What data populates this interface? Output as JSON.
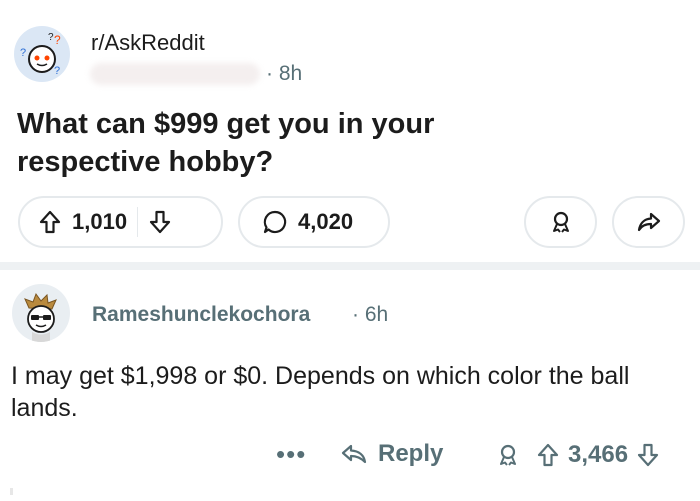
{
  "post": {
    "subreddit": "r/AskReddit",
    "time": "8h",
    "title": "What can $999 get you in your respective hobby?",
    "votes": "1,010",
    "comments": "4,020"
  },
  "comment": {
    "username": "Rameshunclekochora",
    "time": "6h",
    "text": "I may get $1,998 or $0. Depends on which color the ball lands.",
    "reply_label": "Reply",
    "more_label": "•••",
    "votes": "3,466"
  },
  "icons": {
    "upvote": "upvote-arrow-icon",
    "downvote": "downvote-arrow-icon",
    "comment": "comment-bubble-icon",
    "award": "award-ribbon-icon",
    "share": "share-arrow-icon",
    "reply": "reply-arrow-icon"
  },
  "colors": {
    "text": "#1c1c1c",
    "muted": "#576f76",
    "border": "#e5e9ec",
    "separator": "#eef1f3"
  }
}
